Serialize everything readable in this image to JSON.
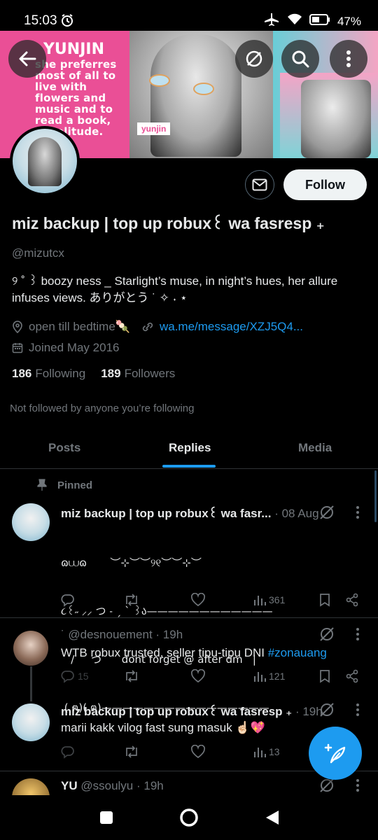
{
  "status_bar": {
    "time": "15:03",
    "battery": "47%"
  },
  "banner": {
    "left_title": "YUNJIN",
    "left_text": "she preferres most of all to live with flowers and music and to read a book, in solitude.",
    "name_tag": "yunjin"
  },
  "profile": {
    "display_name": "miz backup | top up robux꒰ wa fasresp ₊",
    "handle": "@mizutcx",
    "bio": "୨ ˚ ꒱ boozy ness _ Starlight’s muse, in night’s hues, her allure infuses views. ありがとう ˙ ✧ ˖ ⋆",
    "location": "open till bedtime🍡",
    "website": "wa.me/message/XZJ5Q4...",
    "joined": "Joined May 2016",
    "following_count": "186",
    "following_label": "Following",
    "followers_count": "189",
    "followers_label": "Followers",
    "not_followed": "Not followed by anyone you’re following",
    "follow_label": "Follow"
  },
  "tabs": [
    "Posts",
    "Replies",
    "Media"
  ],
  "active_tab": "Replies",
  "pinned_label": "Pinned",
  "posts": [
    {
      "name": "miz backup | top up robux꒰ wa fasr...",
      "meta": "· 08 Aug",
      "lines": [
        "ɷ⩊ɷ       ︶⊹︶︶୨୧︶︶⊹︶",
        "૮꒰˶ ⸝⸝ つ ˗ ˏ ˋ ꒱ა————————————",
        "   /     づ      dont forget @ after dm   |",
        " ( ฅ)( ฅ)————————————————"
      ],
      "views": "361"
    },
    {
      "name": "",
      "handle": "˙ @desnouement",
      "meta": "· 19h",
      "text": "WTB robux trusted, seller tipu-tipu DNI ",
      "hashtag": "#zonauang",
      "replies": "15",
      "views": "121"
    },
    {
      "name": "miz backup | top up robux꒰ wa fasresp ₊",
      "meta": "· 19h",
      "text": "marii kakk vilog fast sung masuk ☝🏻💖",
      "views": "13"
    },
    {
      "name": "YU",
      "handle": "@ssoulyu",
      "meta": "· 19h"
    }
  ],
  "colors": {
    "accent": "#1d9bf0",
    "muted": "#71767b",
    "text": "#e7e9ea",
    "border": "#2f3336"
  }
}
